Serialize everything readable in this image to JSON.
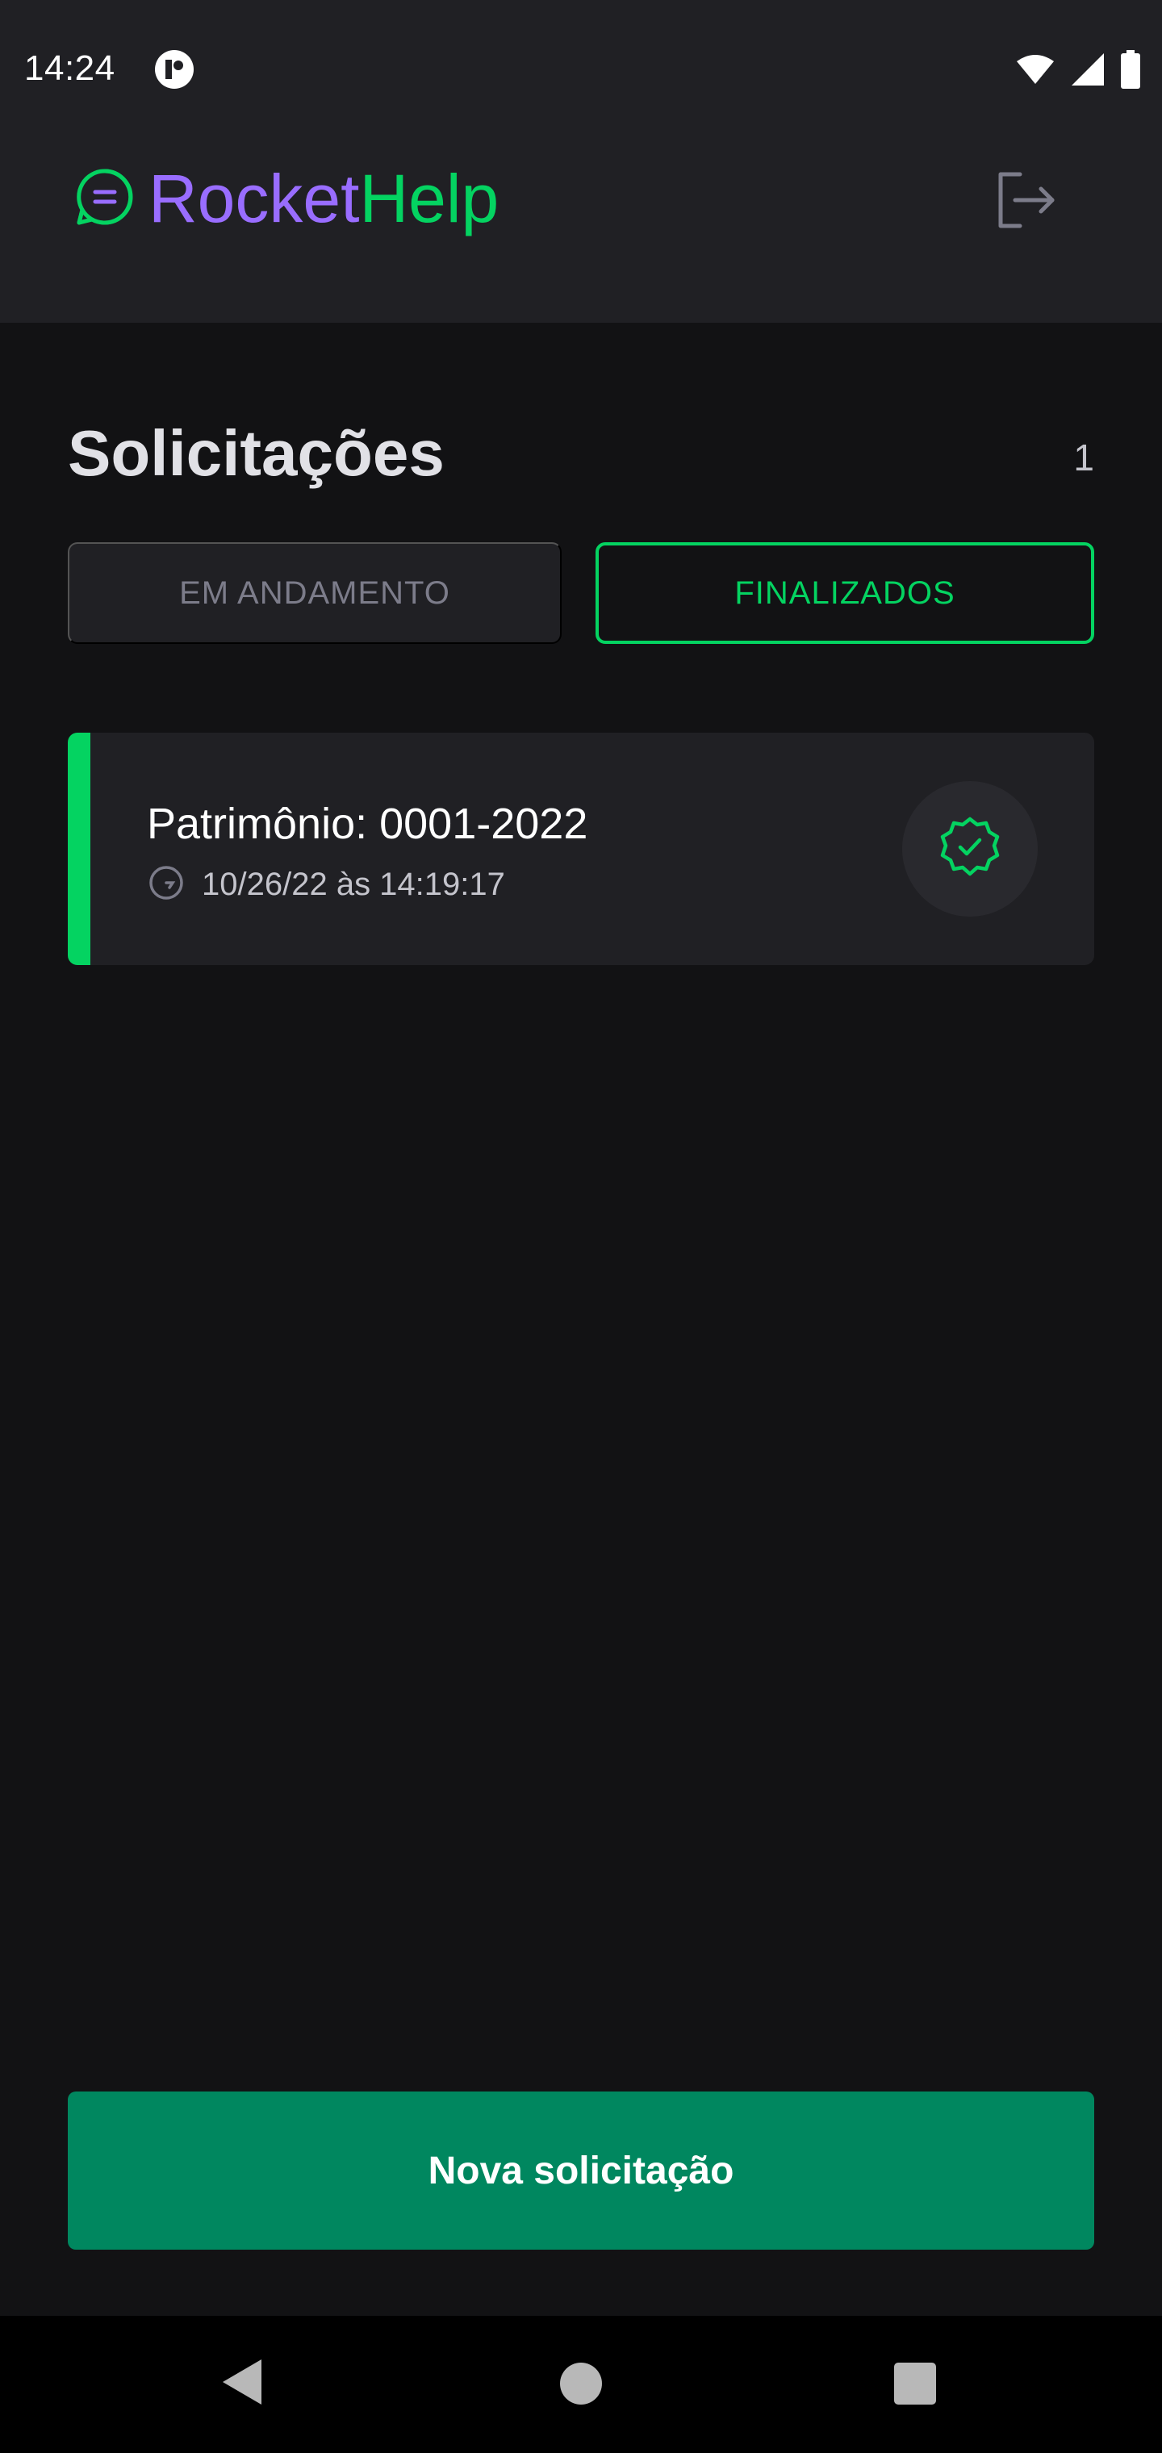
{
  "status_bar": {
    "time": "14:24",
    "icons": [
      "app-notification-icon",
      "wifi-icon",
      "cell-signal-icon",
      "battery-icon"
    ]
  },
  "header": {
    "logo_part1": "Rocket",
    "logo_part2": "Help",
    "logo_icon": "chat-bubble-icon",
    "logout_icon": "sign-out-icon"
  },
  "main": {
    "title": "Solicitações",
    "count": "1",
    "filters": [
      {
        "label": "EM ANDAMENTO",
        "selected": false
      },
      {
        "label": "FINALIZADOS",
        "selected": true
      }
    ],
    "orders": [
      {
        "patrimony": "Patrimônio: 0001-2022",
        "when": "10/26/22 às 14:19:17",
        "status": "closed",
        "status_icon": "circle-wavy-check-icon",
        "time_icon": "clock-icon"
      }
    ],
    "new_button": "Nova solicitação"
  },
  "colors": {
    "accent_green": "#04d361",
    "button_green": "#00875f",
    "purple": "#996dff",
    "surface": "#202024",
    "background": "#121214"
  },
  "nav": {
    "icons": [
      "back-icon",
      "home-icon",
      "recents-icon"
    ]
  }
}
